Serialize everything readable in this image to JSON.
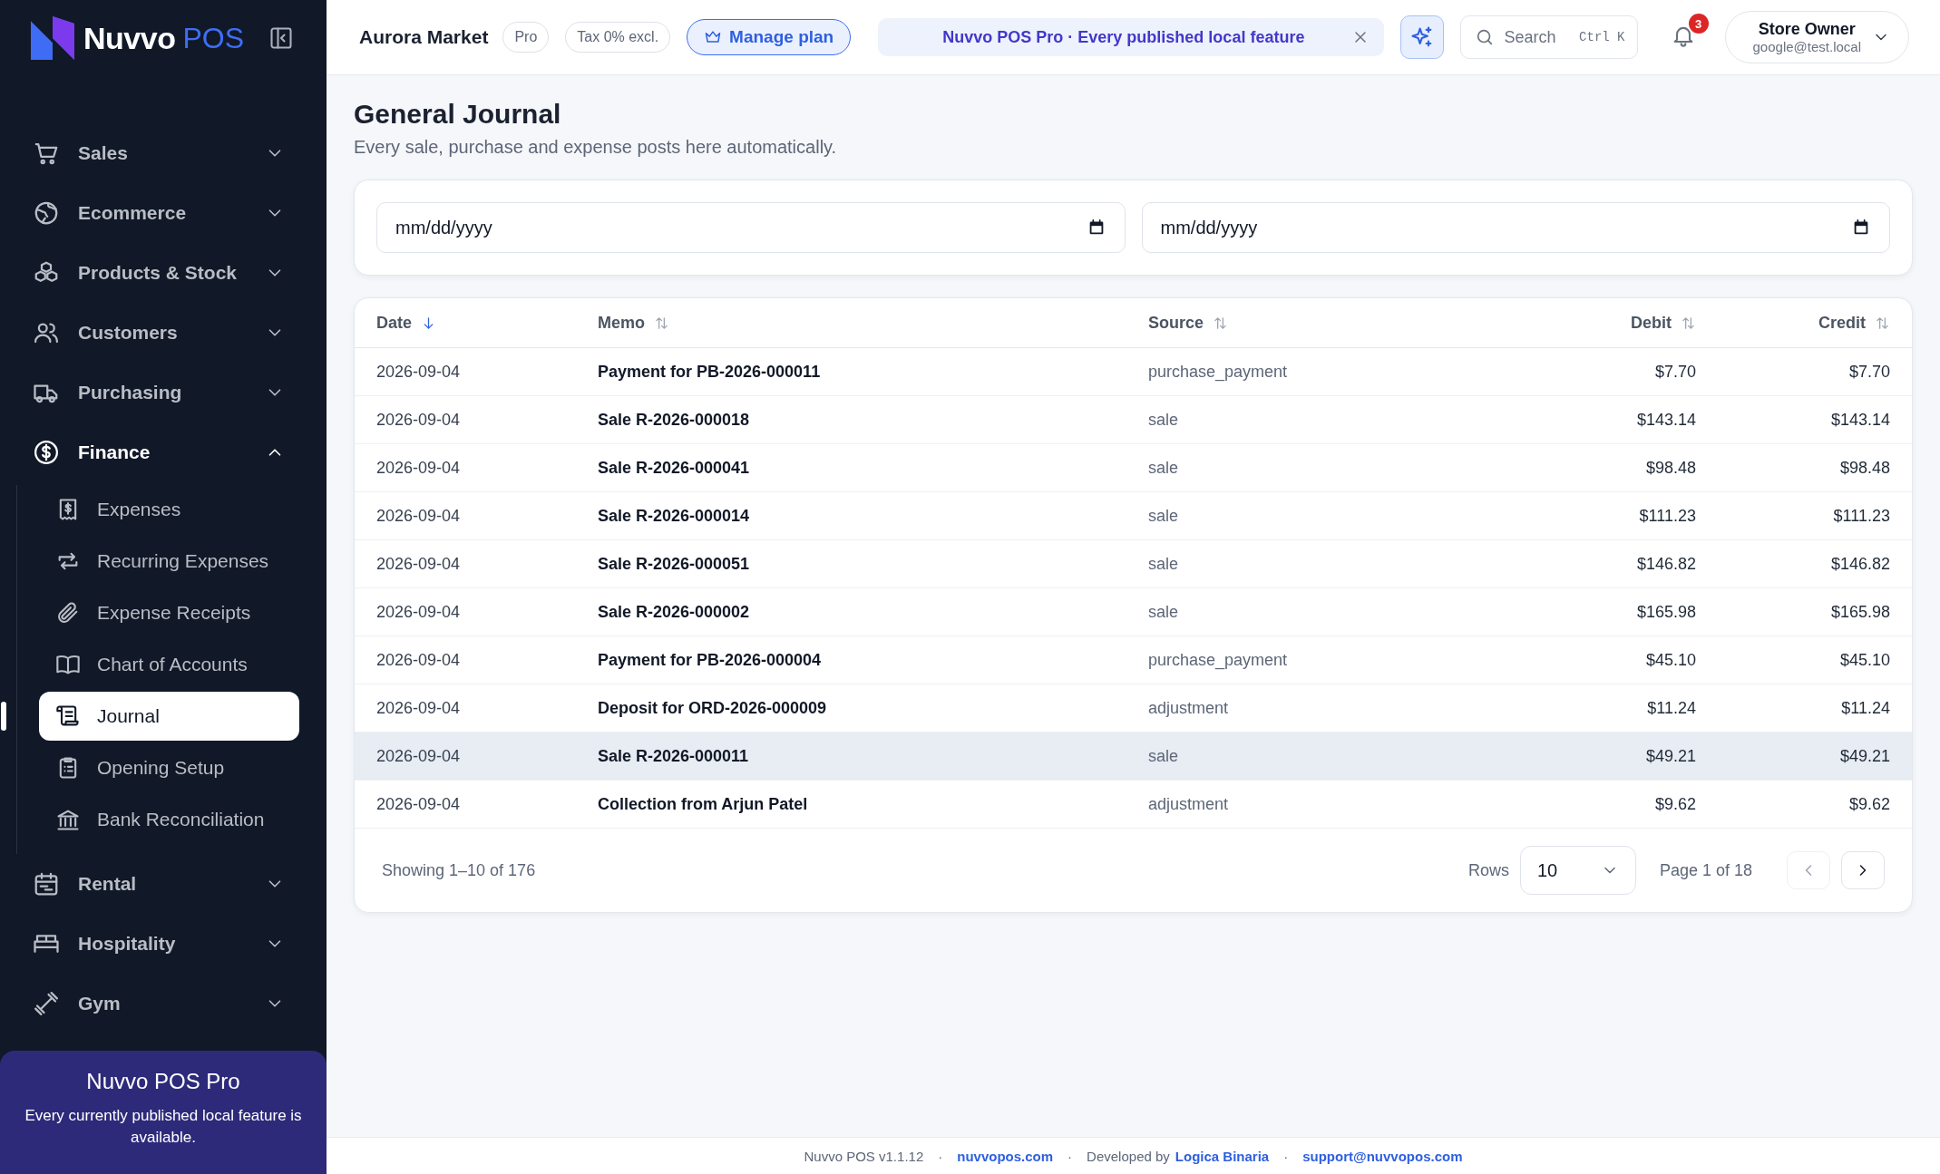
{
  "brand": {
    "name": "Nuvvo",
    "suffix": "POS"
  },
  "sidebar": {
    "items": [
      {
        "label": "Sales",
        "expanded": false
      },
      {
        "label": "Ecommerce",
        "expanded": false
      },
      {
        "label": "Products & Stock",
        "expanded": false
      },
      {
        "label": "Customers",
        "expanded": false
      },
      {
        "label": "Purchasing",
        "expanded": false
      },
      {
        "label": "Finance",
        "expanded": true,
        "children": [
          {
            "label": "Expenses",
            "selected": false
          },
          {
            "label": "Recurring Expenses",
            "selected": false
          },
          {
            "label": "Expense Receipts",
            "selected": false
          },
          {
            "label": "Chart of Accounts",
            "selected": false
          },
          {
            "label": "Journal",
            "selected": true
          },
          {
            "label": "Opening Setup",
            "selected": false
          },
          {
            "label": "Bank Reconciliation",
            "selected": false
          }
        ]
      },
      {
        "label": "Rental",
        "expanded": false
      },
      {
        "label": "Hospitality",
        "expanded": false
      },
      {
        "label": "Gym",
        "expanded": false
      }
    ],
    "promo": {
      "title": "Nuvvo POS Pro",
      "text": "Every currently published local feature is available."
    }
  },
  "topbar": {
    "store": "Aurora Market",
    "badges": [
      "Pro",
      "Tax 0% excl."
    ],
    "manage_button": "Manage plan",
    "banner": "Nuvvo POS Pro · Every published local feature",
    "search": {
      "placeholder": "Search",
      "shortcut": "Ctrl K"
    },
    "notifications": "3",
    "user": {
      "name": "Store Owner",
      "email": "google@test.local"
    }
  },
  "page": {
    "title": "General Journal",
    "subtitle": "Every sale, purchase and expense posts here automatically."
  },
  "filters": [
    {
      "placeholder": "mm/dd/yyyy"
    },
    {
      "placeholder": "mm/dd/yyyy"
    }
  ],
  "table": {
    "columns": [
      {
        "label": "Date",
        "sorted": true,
        "kind": "text"
      },
      {
        "label": "Memo",
        "sorted": false,
        "kind": "text"
      },
      {
        "label": "Source",
        "sorted": false,
        "kind": "text"
      },
      {
        "label": "Debit",
        "sorted": false,
        "kind": "amount"
      },
      {
        "label": "Credit",
        "sorted": false,
        "kind": "amount"
      }
    ],
    "rows": [
      {
        "hovered": false,
        "cells": [
          "2026-09-04",
          "Payment for PB-2026-000011",
          "purchase_payment",
          "$7.70",
          "$7.70"
        ]
      },
      {
        "hovered": false,
        "cells": [
          "2026-09-04",
          "Sale R-2026-000018",
          "sale",
          "$143.14",
          "$143.14"
        ]
      },
      {
        "hovered": false,
        "cells": [
          "2026-09-04",
          "Sale R-2026-000041",
          "sale",
          "$98.48",
          "$98.48"
        ]
      },
      {
        "hovered": false,
        "cells": [
          "2026-09-04",
          "Sale R-2026-000014",
          "sale",
          "$111.23",
          "$111.23"
        ]
      },
      {
        "hovered": false,
        "cells": [
          "2026-09-04",
          "Sale R-2026-000051",
          "sale",
          "$146.82",
          "$146.82"
        ]
      },
      {
        "hovered": false,
        "cells": [
          "2026-09-04",
          "Sale R-2026-000002",
          "sale",
          "$165.98",
          "$165.98"
        ]
      },
      {
        "hovered": false,
        "cells": [
          "2026-09-04",
          "Payment for PB-2026-000004",
          "purchase_payment",
          "$45.10",
          "$45.10"
        ]
      },
      {
        "hovered": false,
        "cells": [
          "2026-09-04",
          "Deposit for ORD-2026-000009",
          "adjustment",
          "$11.24",
          "$11.24"
        ]
      },
      {
        "hovered": true,
        "cells": [
          "2026-09-04",
          "Sale R-2026-000011",
          "sale",
          "$49.21",
          "$49.21"
        ]
      },
      {
        "hovered": false,
        "cells": [
          "2026-09-04",
          "Collection from Arjun Patel",
          "adjustment",
          "$9.62",
          "$9.62"
        ]
      }
    ],
    "summary": "Showing 1–10 of 176",
    "rows_label": "Rows",
    "rows_value": "10",
    "page_info": "Page 1 of 18",
    "prev_disabled": true,
    "next_disabled": false
  },
  "footer": {
    "parts": [
      {
        "kind": "text",
        "text": "Nuvvo POS v1.1.12"
      },
      {
        "kind": "sep",
        "text": "·"
      },
      {
        "kind": "link",
        "text": "nuvvopos.com"
      },
      {
        "kind": "sep",
        "text": "·"
      },
      {
        "kind": "text",
        "text": "Developed by"
      },
      {
        "kind": "link",
        "text": "Logica Binaria"
      },
      {
        "kind": "sep",
        "text": "·"
      },
      {
        "kind": "link",
        "text": "support@nuvvopos.com"
      }
    ]
  }
}
